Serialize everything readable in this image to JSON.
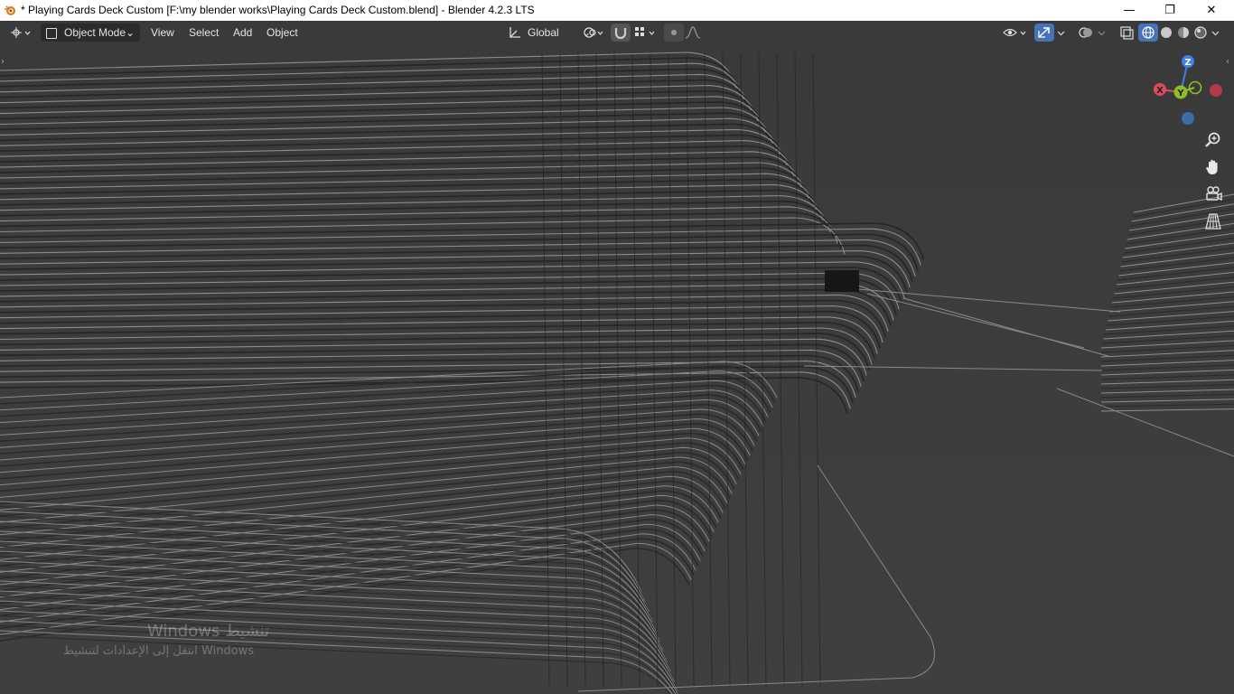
{
  "window": {
    "title": "* Playing Cards Deck Custom [F:\\my blender works\\Playing Cards Deck Custom.blend] - Blender 4.2.3 LTS",
    "minimize": "—",
    "maximize": "❐",
    "close": "✕"
  },
  "header": {
    "mode_label": "Object Mode",
    "menus": {
      "view": "View",
      "select": "Select",
      "add": "Add",
      "object": "Object"
    },
    "orientation_label": "Global"
  },
  "gizmo": {
    "z": "Z",
    "y": "Y",
    "x": "X"
  },
  "watermark": {
    "line1": "Windows تنشيط",
    "line2": "انتقل إلى الإعدادات لتنشيط Windows"
  },
  "colors": {
    "accent": "#4772b3",
    "x_axis": "#e04a5f",
    "y_axis": "#8cbf26",
    "z_axis": "#3b83e0"
  }
}
